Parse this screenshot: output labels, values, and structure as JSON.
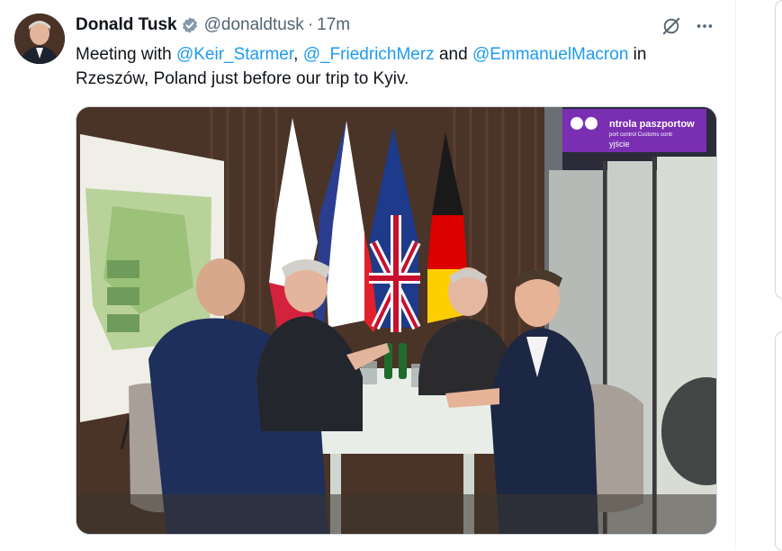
{
  "tweet": {
    "author_name": "Donald Tusk",
    "handle": "@donaldtusk",
    "separator": "·",
    "time": "17m",
    "text_parts": [
      {
        "text": "Meeting with ",
        "type": "plain"
      },
      {
        "text": "@Keir_Starmer",
        "type": "mention"
      },
      {
        "text": ", ",
        "type": "plain"
      },
      {
        "text": "@_FriedrichMerz",
        "type": "mention"
      },
      {
        "text": " and ",
        "type": "plain"
      },
      {
        "text": "@EmmanuelMacron",
        "type": "mention"
      },
      {
        "text": " in Rzeszów, Poland just before our trip to Kyiv.",
        "type": "plain"
      }
    ],
    "photo_sign": {
      "line1": "ntrola paszportow",
      "line2": "port control  Customs contr",
      "line3": "yjście"
    }
  },
  "icons": {
    "verified": "verified-badge-icon",
    "grok": "grok-icon",
    "more": "more-horizontal-icon"
  },
  "colors": {
    "mention": "#1d9bf0",
    "text": "#0f1419",
    "secondary": "#536471",
    "verified": "#829aab"
  }
}
